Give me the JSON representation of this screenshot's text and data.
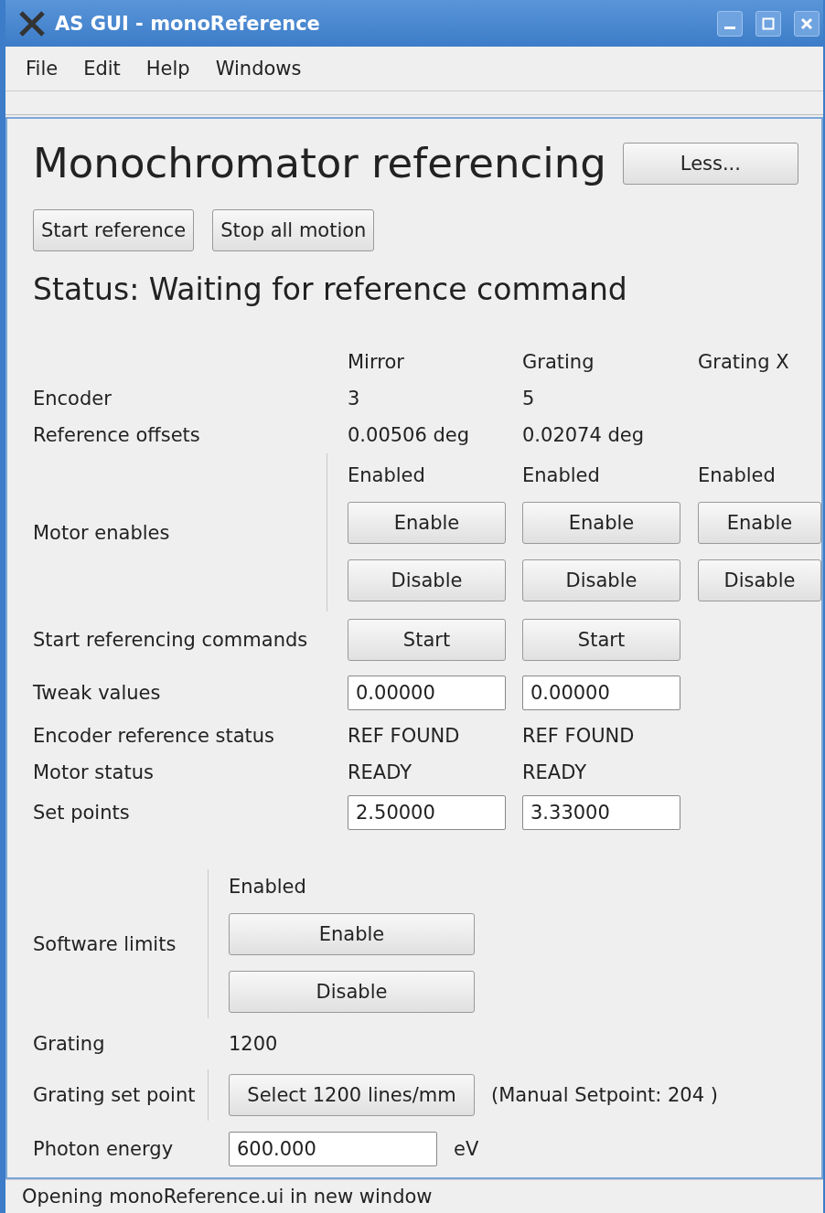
{
  "window": {
    "title": "AS GUI - monoReference"
  },
  "menu": [
    "File",
    "Edit",
    "Help",
    "Windows"
  ],
  "heading": "Monochromator referencing",
  "less_button": "Less...",
  "actions": [
    "Start reference",
    "Stop all motion"
  ],
  "status": "Status: Waiting for reference command",
  "axes": [
    "Mirror",
    "Grating",
    "Grating X"
  ],
  "rows": [
    {
      "label": "Encoder",
      "kind": "text",
      "cells": [
        "3",
        "5"
      ]
    },
    {
      "label": "Reference offsets",
      "kind": "text",
      "cells": [
        "0.00506 deg",
        "0.02074 deg"
      ]
    },
    {
      "label": "Motor enables",
      "kind": "enables",
      "cells": [
        {
          "state": "Enabled",
          "enable": "Enable",
          "disable": "Disable"
        },
        {
          "state": "Enabled",
          "enable": "Enable",
          "disable": "Disable"
        },
        {
          "state": "Enabled",
          "enable": "Enable",
          "disable": "Disable"
        }
      ]
    },
    {
      "label": "Start referencing commands",
      "kind": "button",
      "cells": [
        "Start",
        "Start"
      ]
    },
    {
      "label": "Tweak values",
      "kind": "input",
      "cells": [
        "0.00000",
        "0.00000"
      ]
    },
    {
      "label": "Encoder reference status",
      "kind": "text",
      "cells": [
        "REF FOUND",
        "REF FOUND"
      ]
    },
    {
      "label": "Motor status",
      "kind": "text",
      "cells": [
        "READY",
        "READY"
      ]
    },
    {
      "label": "Set points",
      "kind": "input",
      "cells": [
        "2.50000",
        "3.33000"
      ]
    }
  ],
  "software_limits": {
    "label": "Software limits",
    "state": "Enabled",
    "enable": "Enable",
    "disable": "Disable"
  },
  "grating": {
    "label": "Grating",
    "value": "1200"
  },
  "grating_set_point": {
    "label": "Grating set point",
    "button": "Select 1200 lines/mm",
    "note": "(Manual Setpoint: 204 )"
  },
  "photon_energy": {
    "label": "Photon energy",
    "value": "600.000",
    "unit": "eV"
  },
  "status_bar": "Opening monoReference.ui in new window"
}
